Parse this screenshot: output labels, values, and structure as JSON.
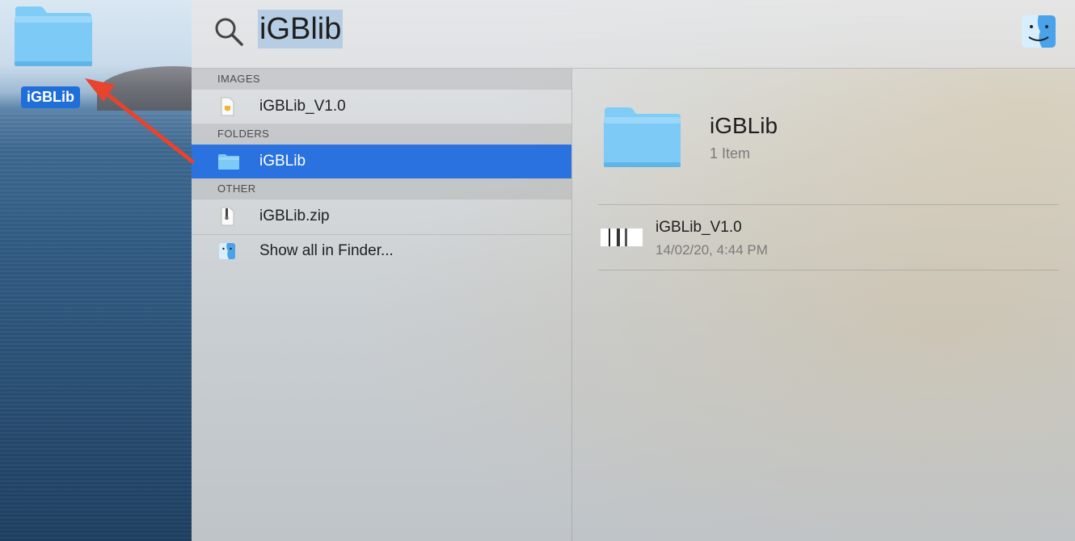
{
  "desktop": {
    "folder_label": "iGBLib"
  },
  "search": {
    "query": "iGBlib"
  },
  "results": {
    "sections": [
      {
        "header": "IMAGES",
        "items": [
          {
            "label": "iGBLib_V1.0",
            "icon": "image-file-icon"
          }
        ]
      },
      {
        "header": "FOLDERS",
        "items": [
          {
            "label": "iGBLib",
            "icon": "folder-icon",
            "selected": true
          }
        ]
      },
      {
        "header": "OTHER",
        "items": [
          {
            "label": "iGBLib.zip",
            "icon": "zip-file-icon"
          },
          {
            "label": "Show all in Finder...",
            "icon": "finder-icon"
          }
        ]
      }
    ]
  },
  "preview": {
    "title": "iGBLib",
    "subtitle": "1 Item",
    "item_name": "iGBLib_V1.0",
    "item_date": "14/02/20, 4:44 PM"
  },
  "colors": {
    "selection": "#2a72e0",
    "desktop_label_bg": "#1f6fd9",
    "arrow": "#e8432c",
    "folder": "#6fc3f3"
  }
}
